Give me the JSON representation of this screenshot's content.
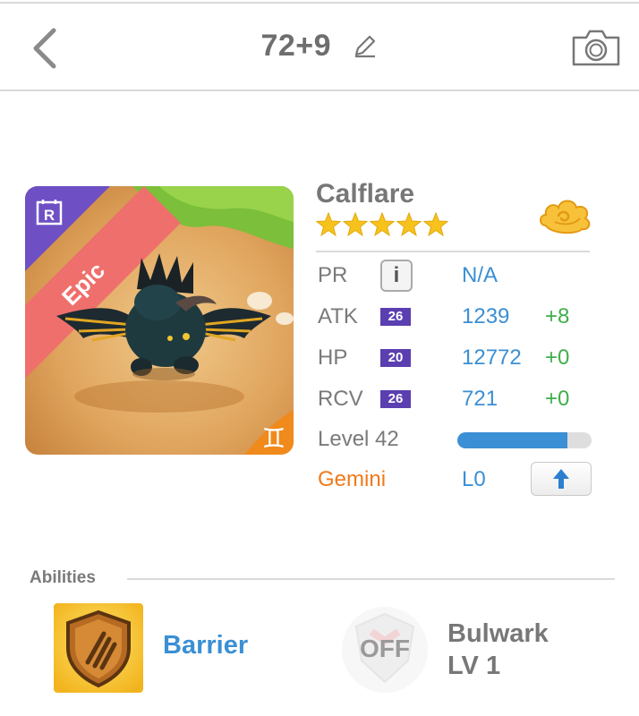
{
  "header": {
    "title": "72+9"
  },
  "card": {
    "rarity_label": "Epic",
    "rarity_badge": "R",
    "zodiac_symbol": "♊"
  },
  "monster": {
    "name": "Calflare",
    "stars": 5,
    "element_icon": "cloud-icon"
  },
  "stats": {
    "pr": {
      "label": "PR",
      "value": "N/A"
    },
    "atk": {
      "label": "ATK",
      "badge": "26",
      "value": "1239",
      "bonus": "+8"
    },
    "hp": {
      "label": "HP",
      "badge": "20",
      "value": "12772",
      "bonus": "+0"
    },
    "rcv": {
      "label": "RCV",
      "badge": "26",
      "value": "721",
      "bonus": "+0"
    },
    "level": {
      "label": "Level 42",
      "progress": 0.82
    },
    "zodiac": {
      "label": "Gemini",
      "value": "L0"
    }
  },
  "abilities": {
    "title": "Abilities",
    "items": [
      {
        "name": "Barrier",
        "icon": "shield-claw-icon"
      },
      {
        "name": "Bulwark",
        "level": "LV 1",
        "status": "OFF"
      }
    ]
  },
  "colors": {
    "accent_blue": "#3b8fd4",
    "bonus_green": "#3fae49",
    "zodiac_orange": "#ef7a1a",
    "epic_red": "#ef6f6c",
    "badge_purple": "#5b3fb0"
  }
}
